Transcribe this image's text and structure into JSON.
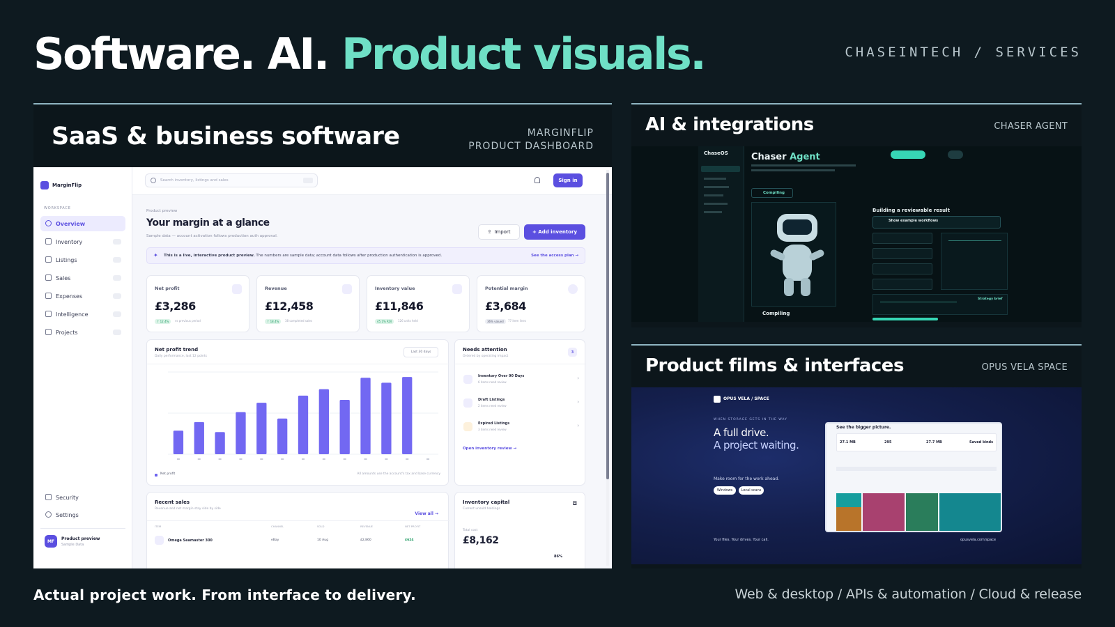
{
  "headline": {
    "part1": "Software. AI.",
    "part2": "Product visuals."
  },
  "brand": "CHASEINTECH / SERVICES",
  "colors": {
    "accent": "#6fe0c6",
    "background": "#0e1a20",
    "dashboard_primary": "#5b4fe0"
  },
  "panel_saas": {
    "title": "SaaS & business software",
    "subtitle_line1": "MARGINFLIP",
    "subtitle_line2": "PRODUCT DASHBOARD",
    "dashboard": {
      "logo": "MarginFlip",
      "search_placeholder": "Search inventory, listings and sales",
      "sign_in": "Sign in",
      "section_label": "WORKSPACE",
      "nav": [
        "Overview",
        "Inventory",
        "Listings",
        "Sales",
        "Expenses",
        "Intelligence",
        "Projects"
      ],
      "nav_bottom": [
        "Security",
        "Settings"
      ],
      "user": {
        "initials": "MF",
        "name": "Product preview",
        "sub": "Sample Data"
      },
      "eyebrow": "Product preview",
      "heading": "Your margin at a glance",
      "subheading": "Sample data — account activation follows production auth approval.",
      "import_button": "Import",
      "add_button": "+ Add inventory",
      "banner_bold": "This is a live, interactive product preview.",
      "banner_rest": "The numbers are sample data; account data follows after production authentication is approved.",
      "banner_link": "See the access plan →",
      "kpis": [
        {
          "label": "Net profit",
          "value": "£3,286",
          "badge": "↑ 12.4%",
          "note": "vs previous period"
        },
        {
          "label": "Revenue",
          "value": "£12,458",
          "badge": "↑ 18.4%",
          "note": "38 completed sales"
        },
        {
          "label": "Inventory value",
          "value": "£11,846",
          "badge": "45.1% ROI",
          "note": "126 units held"
        },
        {
          "label": "Potential margin",
          "value": "£3,684",
          "badge": "36% valued",
          "note": "77 item lines"
        }
      ],
      "trend": {
        "title": "Net profit trend",
        "subtitle": "Daily performance, last 12 points",
        "range": "Last 30 days",
        "legend": "Net profit",
        "footnote": "All amounts use the account's tax and base currency"
      },
      "attention": {
        "title": "Needs attention",
        "subtitle": "Ordered by operating impact",
        "count": "3",
        "items": [
          {
            "title": "Inventory Over 90 Days",
            "sub": "6 items need review"
          },
          {
            "title": "Draft Listings",
            "sub": "2 items need review"
          },
          {
            "title": "Expired Listings",
            "sub": "3 items need review"
          }
        ],
        "link": "Open inventory review →"
      },
      "recent_sales": {
        "title": "Recent sales",
        "subtitle": "Revenue and net margin stay side by side",
        "view_all": "View all →",
        "columns": [
          "ITEM",
          "CHANNEL",
          "SOLD",
          "REVENUE",
          "NET PROFIT"
        ],
        "rows": [
          {
            "item": "Omega Seamaster 300",
            "channel": "eBay",
            "sold": "10 Aug",
            "revenue": "£2,860",
            "profit": "£624"
          }
        ]
      },
      "capital": {
        "title": "Inventory capital",
        "subtitle": "Current unsold holdings",
        "label": "Total cost",
        "value": "£8,162",
        "pct": "86%"
      }
    }
  },
  "panel_ai": {
    "title": "AI & integrations",
    "subtitle": "CHASER AGENT",
    "app": {
      "logo": "ChaseOS",
      "title_part1": "Chaser",
      "title_part2": "Agent",
      "status": "Compiling",
      "result_title": "Building a reviewable result",
      "workflow": "Show example workflows",
      "compiling": "Compiling",
      "step_label": "Strategy brief"
    }
  },
  "panel_films": {
    "title": "Product films & interfaces",
    "subtitle": "OPUS VELA SPACE",
    "promo": {
      "logo": "OPUS VELA / SPACE",
      "eyebrow": "WHEN STORAGE GETS IN THE WAY",
      "line1": "A full drive.",
      "line2": "A project waiting.",
      "tagline": "Make room for the work ahead.",
      "pill1": "Windows",
      "pill2": "Local scans",
      "footer": "Your files. Your drives. Your call.",
      "url": "opusvela.com/space",
      "screen_title": "See the bigger picture.",
      "stats": [
        "27.1 MB",
        "295",
        "27.7 MB",
        "Saved kinds"
      ]
    }
  },
  "chart_data": {
    "type": "bar",
    "title": "Net profit trend",
    "categories": [
      "1",
      "2",
      "3",
      "4",
      "5",
      "6",
      "7",
      "8",
      "9",
      "10",
      "11",
      "12",
      "13"
    ],
    "values": [
      33,
      45,
      31,
      59,
      72,
      50,
      82,
      91,
      76,
      107,
      100,
      108,
      0
    ],
    "ylim": [
      0,
      115
    ]
  },
  "footer": {
    "tagline": "Actual project work. From interface to delivery.",
    "services": "Web & desktop / APIs & automation / Cloud & release"
  }
}
